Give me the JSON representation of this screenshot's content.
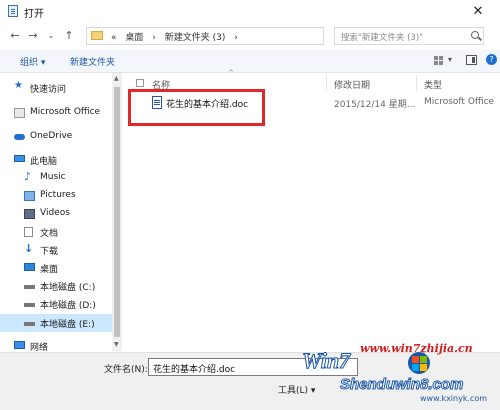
{
  "window": {
    "title": "打开",
    "close_glyph": "✕"
  },
  "nav_buttons": {
    "back": "←",
    "forward": "→",
    "dropdown": "⌄",
    "up": "↑"
  },
  "address": {
    "overflow": "«",
    "crumbs": [
      "桌面",
      "›",
      "新建文件夹 (3)",
      "›"
    ],
    "dropdown": "⌄",
    "refresh": "↻"
  },
  "search": {
    "placeholder": "搜索\"新建文件夹 (3)\""
  },
  "toolbar": {
    "organize": "组织 ▾",
    "new_folder": "新建文件夹",
    "view_dropdown": "▾",
    "help": "?"
  },
  "sidebar": {
    "items": [
      {
        "label": "快速访问",
        "icon": "star-icon"
      },
      {
        "label": "Microsoft Office",
        "icon": "office-icon"
      },
      {
        "label": "OneDrive",
        "icon": "cloud-icon"
      },
      {
        "label": "此电脑",
        "icon": "computer-icon"
      },
      {
        "label": "Music",
        "icon": "music-icon"
      },
      {
        "label": "Pictures",
        "icon": "pictures-icon"
      },
      {
        "label": "Videos",
        "icon": "videos-icon"
      },
      {
        "label": "文档",
        "icon": "documents-icon"
      },
      {
        "label": "下载",
        "icon": "download-icon"
      },
      {
        "label": "桌面",
        "icon": "desktop-icon"
      },
      {
        "label": "本地磁盘 (C:)",
        "icon": "drive-icon"
      },
      {
        "label": "本地磁盘 (D:)",
        "icon": "drive-icon"
      },
      {
        "label": "本地磁盘 (E:)",
        "icon": "drive-icon",
        "selected": true
      },
      {
        "label": "网络",
        "icon": "network-icon"
      }
    ]
  },
  "columns": {
    "name": "名称",
    "date": "修改日期",
    "type": "类型"
  },
  "files": [
    {
      "name": "花生的基本介绍.doc",
      "date": "2015/12/14 星期...",
      "type": "Microsoft Office"
    }
  ],
  "bottom": {
    "filename_label": "文件名(N):",
    "filename_value": "花生的基本介绍.doc",
    "tools": "工具(L) ▾"
  },
  "watermark": {
    "top": "www.win7zhijia.cn",
    "logo": "Win7",
    "brand": "Shenduwin8.com",
    "url": "www.kxinyk.com"
  },
  "colors": {
    "highlight": "#e0282a",
    "accent": "#1e5aa8",
    "selected": "#cce8ff"
  }
}
